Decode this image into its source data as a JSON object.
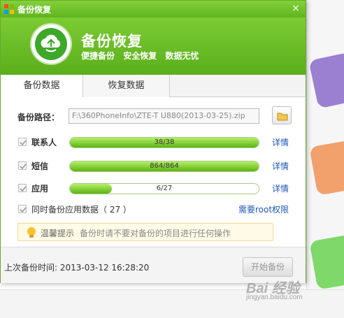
{
  "window": {
    "title": "备份恢复",
    "close_glyph": "×",
    "header_title": "备份恢复",
    "header_features": [
      "便捷备份",
      "安全恢复",
      "数据无忧"
    ]
  },
  "tabs": [
    {
      "label": "备份数据",
      "active": true
    },
    {
      "label": "恢复数据",
      "active": false
    }
  ],
  "backup_path": {
    "label": "备份路径：",
    "value": "F:\\360PhoneInfo\\ZTE-T U880(2013-03-25).zip"
  },
  "items": [
    {
      "label": "联系人",
      "progress_text": "38/38",
      "fraction": 1.0,
      "link": "详情",
      "checked": true
    },
    {
      "label": "短信",
      "progress_text": "864/864",
      "fraction": 1.0,
      "link": "详情",
      "checked": true
    },
    {
      "label": "应用",
      "progress_text": "6/27",
      "fraction": 0.222,
      "link": "详情",
      "checked": true
    }
  ],
  "sync_apps": {
    "label": "同时备份应用数据（ 27 ）",
    "checked": true,
    "root_link": "需要root权限"
  },
  "tip": {
    "title": "温馨提示",
    "text": "备份时请不要对备份的项目进行任何操作"
  },
  "footer": {
    "last_backup": "上次备份时间: 2013-03-12 16:28:20",
    "start_button": "开始备份"
  },
  "watermark": {
    "main": "Bai 经验",
    "sub": "jingyan.baidu.com"
  },
  "colors": {
    "brand_green": "#5fb51f",
    "link_blue": "#1f56b5",
    "tip_bg": "#fffbe6"
  },
  "icons": {
    "logo": "recycle-cloud-icon",
    "folder": "folder-icon",
    "tip": "lightbulb-icon",
    "check": "check-icon"
  }
}
